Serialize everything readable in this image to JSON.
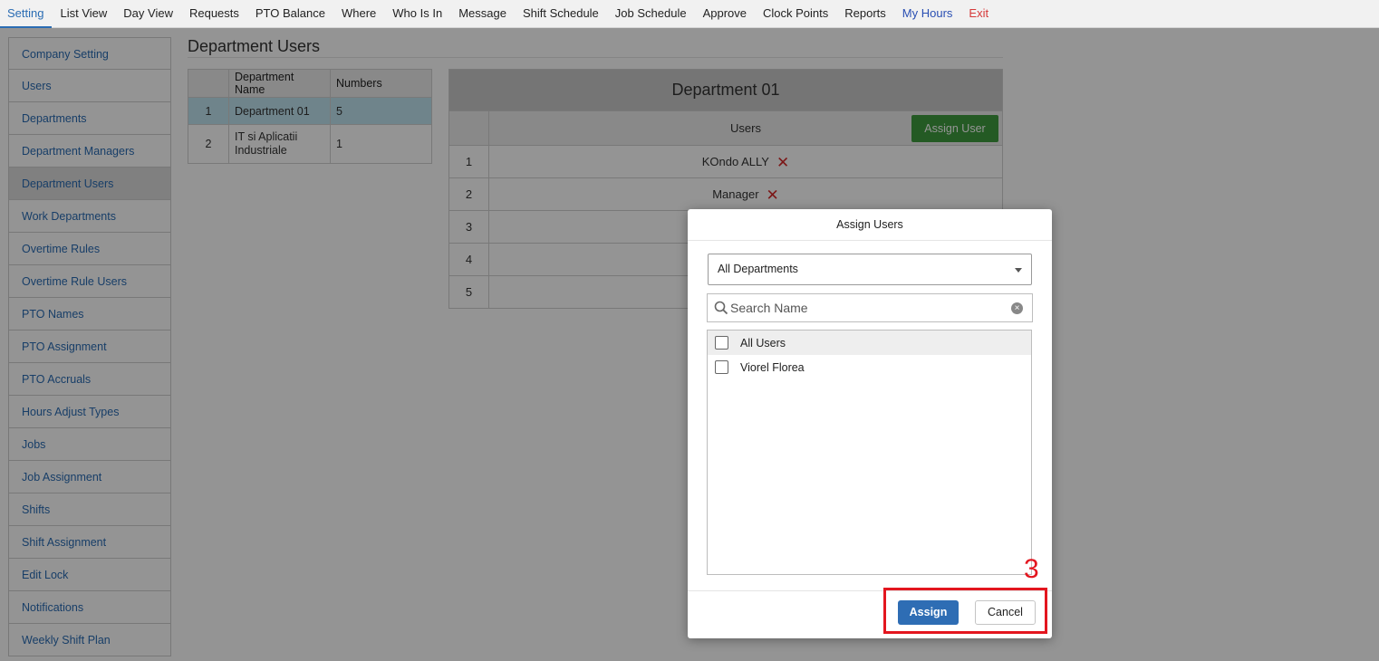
{
  "nav": {
    "items": [
      "Setting",
      "List View",
      "Day View",
      "Requests",
      "PTO Balance",
      "Where",
      "Who Is In",
      "Message",
      "Shift Schedule",
      "Job Schedule",
      "Approve",
      "Clock Points",
      "Reports",
      "My Hours",
      "Exit"
    ],
    "active": "Setting"
  },
  "sidebar": {
    "items": [
      "Company Setting",
      "Users",
      "Departments",
      "Department Managers",
      "Department Users",
      "Work Departments",
      "Overtime Rules",
      "Overtime Rule Users",
      "PTO Names",
      "PTO Assignment",
      "PTO Accruals",
      "Hours Adjust Types",
      "Jobs",
      "Job Assignment",
      "Shifts",
      "Shift Assignment",
      "Edit Lock",
      "Notifications",
      "Weekly Shift Plan"
    ],
    "active": "Department Users"
  },
  "page": {
    "title": "Department Users"
  },
  "dept_table": {
    "headers": [
      "",
      "Department Name",
      "Numbers"
    ],
    "rows": [
      {
        "idx": "1",
        "name": "Department 01",
        "numbers": "5"
      },
      {
        "idx": "2",
        "name": "IT si Aplicatii Industriale",
        "numbers": "1"
      }
    ]
  },
  "users_panel": {
    "title": "Department 01",
    "col_header": "Users",
    "assign_user_label": "Assign User",
    "rows": [
      {
        "idx": "1",
        "name": "KOndo ALLY"
      },
      {
        "idx": "2",
        "name": "Manager"
      },
      {
        "idx": "3",
        "name": ""
      },
      {
        "idx": "4",
        "name": ""
      },
      {
        "idx": "5",
        "name": ""
      }
    ]
  },
  "modal": {
    "title": "Assign Users",
    "department_select": "All Departments",
    "search_placeholder": "Search Name",
    "list": [
      "All Users",
      "Viorel Florea"
    ],
    "assign_label": "Assign",
    "cancel_label": "Cancel"
  },
  "annotation": {
    "number": "3",
    "color": "#e3161f"
  }
}
